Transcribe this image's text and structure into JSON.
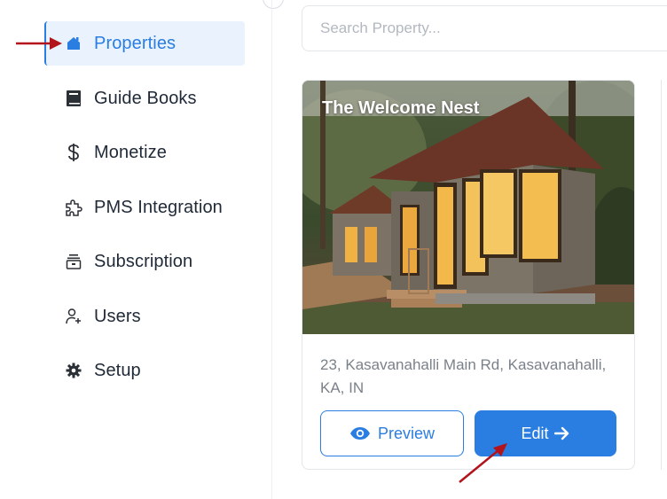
{
  "sidebar": {
    "items": [
      {
        "label": "Properties",
        "icon": "home-icon",
        "active": true
      },
      {
        "label": "Guide Books",
        "icon": "book-icon"
      },
      {
        "label": "Monetize",
        "icon": "dollar-icon"
      },
      {
        "label": "PMS Integration",
        "icon": "puzzle-icon"
      },
      {
        "label": "Subscription",
        "icon": "subscription-icon"
      },
      {
        "label": "Users",
        "icon": "user-add-icon"
      },
      {
        "label": "Setup",
        "icon": "gear-icon"
      }
    ]
  },
  "search": {
    "placeholder": "Search Property..."
  },
  "property_card": {
    "title": "The Welcome Nest",
    "address": "23, Kasavanahalli Main Rd, Kasavanahalli, KA, IN",
    "preview_label": "Preview",
    "edit_label": "Edit"
  },
  "colors": {
    "accent": "#2a7de1",
    "active_bg": "#e9f2fd",
    "annotation_arrow": "#b3141b"
  }
}
